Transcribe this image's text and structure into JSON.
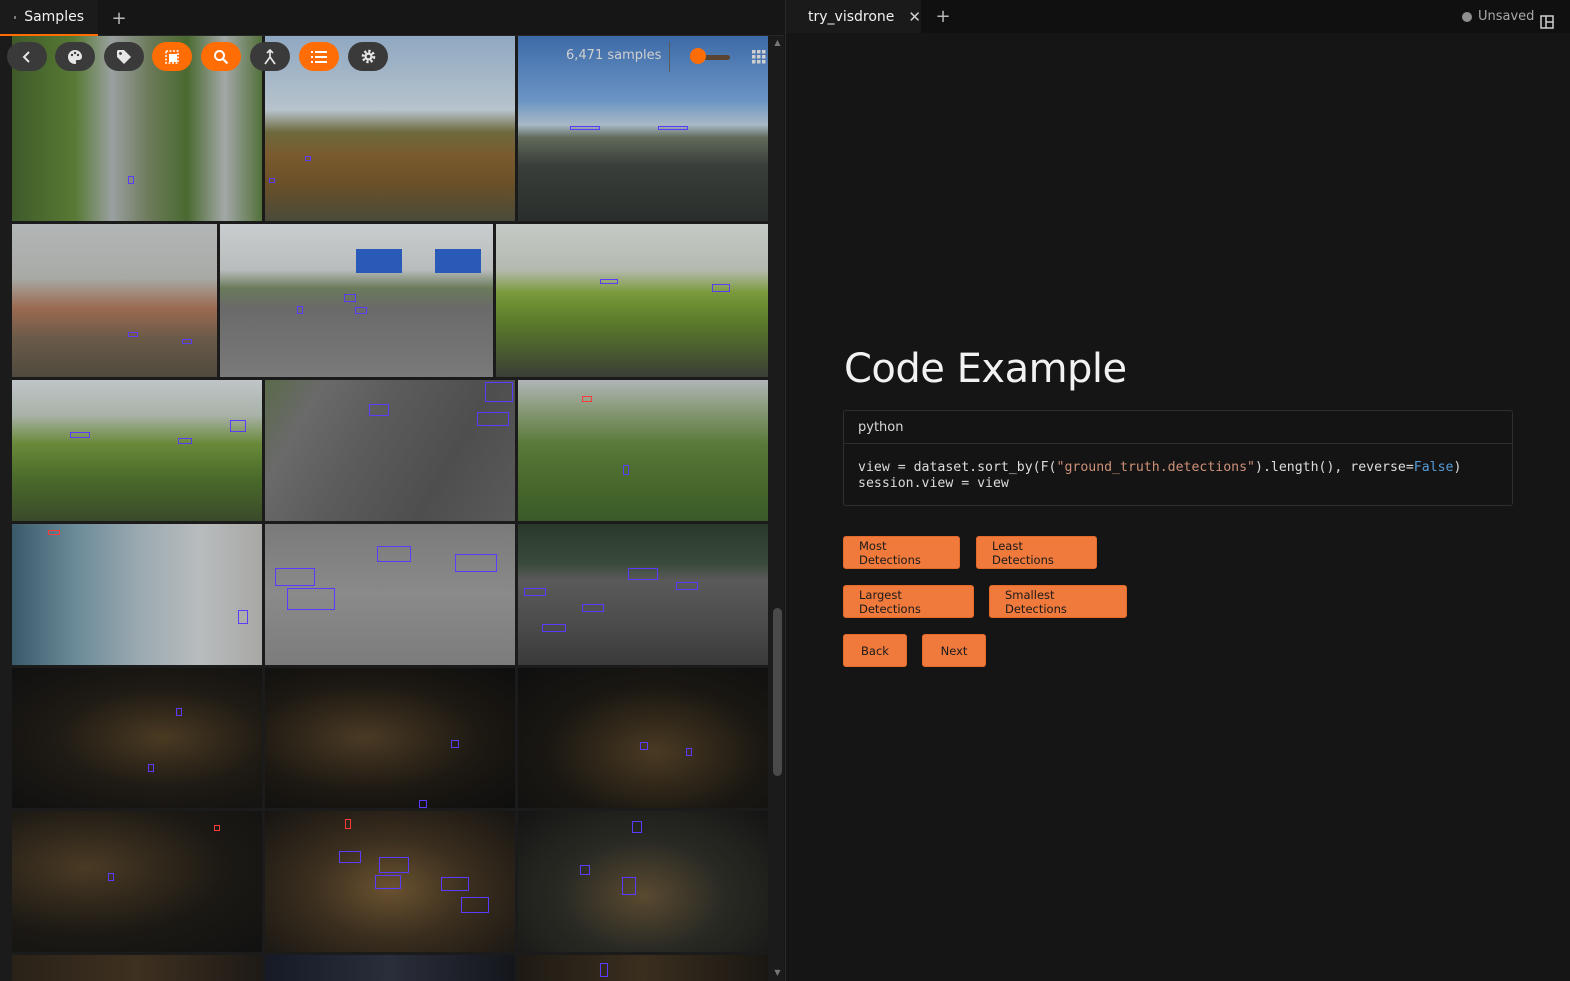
{
  "left_panel": {
    "tab": {
      "label": "Samples"
    },
    "sample_count": "6,471 samples",
    "zoom_level": 0.2,
    "accent_color": "#ff6d04",
    "toolbar_icons": [
      "chevron-left-icon",
      "palette-icon",
      "tag-icon",
      "select-patches-icon",
      "search-icon",
      "merge-icon",
      "list-icon",
      "gear-icon"
    ]
  },
  "right_panel": {
    "tab": {
      "label": "try_visdrone"
    },
    "status": "Unsaved",
    "title": "Code Example",
    "code": {
      "language": "python",
      "line1_a": "view = dataset.sort_by(F(",
      "line1_str": "\"ground_truth.detections\"",
      "line1_b": ").length(), reverse=",
      "line1_kw": "False",
      "line1_c": ")",
      "line2": "session.view = view"
    },
    "buttons": {
      "most": "Most Detections",
      "least": "Least Detections",
      "largest": "Largest Detections",
      "smallest": "Smallest Detections",
      "back": "Back",
      "next": "Next"
    }
  }
}
